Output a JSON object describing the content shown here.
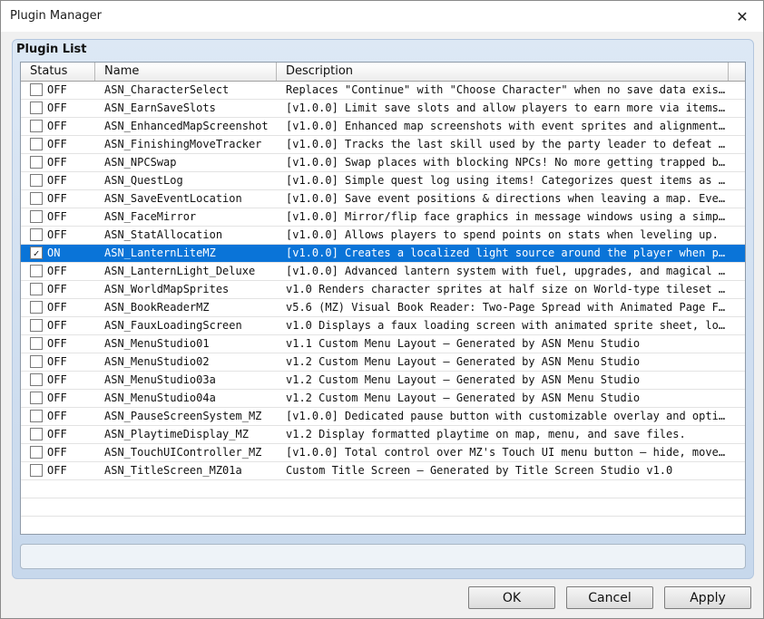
{
  "window": {
    "title": "Plugin Manager"
  },
  "group": {
    "title": "Plugin List"
  },
  "columns": {
    "status": "Status",
    "name": "Name",
    "description": "Description"
  },
  "plugins": [
    {
      "checked": false,
      "status": "OFF",
      "name": "ASN_CharacterSelect",
      "description": "Replaces \"Continue\" with \"Choose Character\" when no save data exist…"
    },
    {
      "checked": false,
      "status": "OFF",
      "name": "ASN_EarnSaveSlots",
      "description": "[v1.0.0] Limit save slots and allow players to earn more via items.…"
    },
    {
      "checked": false,
      "status": "OFF",
      "name": "ASN_EnhancedMapScreenshot",
      "description": "[v1.0.0] Enhanced map screenshots with event sprites and alignment …"
    },
    {
      "checked": false,
      "status": "OFF",
      "name": "ASN_FinishingMoveTracker",
      "description": "[v1.0.0] Tracks the last skill used by the party leader to defeat a…"
    },
    {
      "checked": false,
      "status": "OFF",
      "name": "ASN_NPCSwap",
      "description": "[v1.0.0] Swap places with blocking NPCs! No more getting trapped by…"
    },
    {
      "checked": false,
      "status": "OFF",
      "name": "ASN_QuestLog",
      "description": "[v1.0.0] Simple quest log using items! Categorizes quest items as A…"
    },
    {
      "checked": false,
      "status": "OFF",
      "name": "ASN_SaveEventLocation",
      "description": "[v1.0.0] Save event positions & directions when leaving a map. Even…"
    },
    {
      "checked": false,
      "status": "OFF",
      "name": "ASN_FaceMirror",
      "description": "[v1.0.0] Mirror/flip face graphics in message windows using a simpl…"
    },
    {
      "checked": false,
      "status": "OFF",
      "name": "ASN_StatAllocation",
      "description": "[v1.0.0] Allows players to spend points on stats when leveling up."
    },
    {
      "checked": true,
      "status": "ON",
      "name": "ASN_LanternLiteMZ",
      "description": "[v1.0.0] Creates a localized light source around the player when po…",
      "selected": true
    },
    {
      "checked": false,
      "status": "OFF",
      "name": "ASN_LanternLight_Deluxe",
      "description": "[v1.0.0] Advanced lantern system with fuel, upgrades, and magical l…"
    },
    {
      "checked": false,
      "status": "OFF",
      "name": "ASN_WorldMapSprites",
      "description": "v1.0 Renders character sprites at half size on World-type tileset m…"
    },
    {
      "checked": false,
      "status": "OFF",
      "name": "ASN_BookReaderMZ",
      "description": "v5.6 (MZ) Visual Book Reader: Two-Page Spread with Animated Page Fl…"
    },
    {
      "checked": false,
      "status": "OFF",
      "name": "ASN_FauxLoadingScreen",
      "description": "v1.0 Displays a faux loading screen with animated sprite sheet, loa…"
    },
    {
      "checked": false,
      "status": "OFF",
      "name": "ASN_MenuStudio01",
      "description": "v1.1 Custom Menu Layout — Generated by ASN Menu Studio"
    },
    {
      "checked": false,
      "status": "OFF",
      "name": "ASN_MenuStudio02",
      "description": "v1.2 Custom Menu Layout — Generated by ASN Menu Studio"
    },
    {
      "checked": false,
      "status": "OFF",
      "name": "ASN_MenuStudio03a",
      "description": "v1.2 Custom Menu Layout — Generated by ASN Menu Studio"
    },
    {
      "checked": false,
      "status": "OFF",
      "name": "ASN_MenuStudio04a",
      "description": "v1.2 Custom Menu Layout — Generated by ASN Menu Studio"
    },
    {
      "checked": false,
      "status": "OFF",
      "name": "ASN_PauseScreenSystem_MZ",
      "description": "[v1.0.0] Dedicated pause button with customizable overlay and optio…"
    },
    {
      "checked": false,
      "status": "OFF",
      "name": "ASN_PlaytimeDisplay_MZ",
      "description": "v1.2 Display formatted playtime on map, menu, and save files."
    },
    {
      "checked": false,
      "status": "OFF",
      "name": "ASN_TouchUIController_MZ",
      "description": "[v1.0.0] Total control over MZ's Touch UI menu button — hide, move,…"
    },
    {
      "checked": false,
      "status": "OFF",
      "name": "ASN_TitleScreen_MZ01a",
      "description": "Custom Title Screen — Generated by Title Screen Studio v1.0"
    }
  ],
  "buttons": {
    "ok": "OK",
    "cancel": "Cancel",
    "apply": "Apply"
  },
  "icons": {
    "close": "close-icon",
    "check": "checkmark-icon"
  },
  "colors": {
    "selection": "#0a74d8",
    "group_bg": "#dde8f5"
  }
}
